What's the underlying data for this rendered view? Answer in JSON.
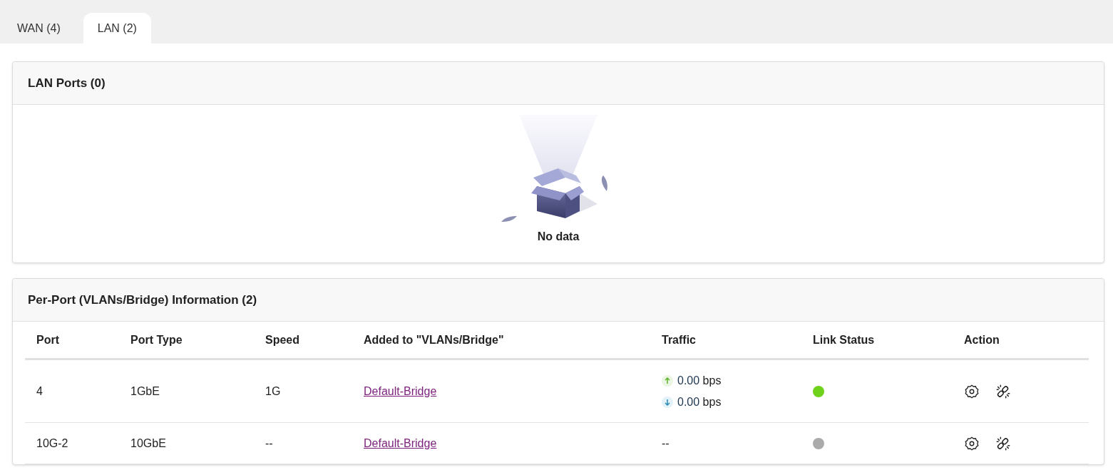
{
  "tabs": [
    {
      "label": "WAN (4)",
      "selected": false
    },
    {
      "label": "LAN (2)",
      "selected": true
    }
  ],
  "lan_ports": {
    "title": "LAN Ports (0)",
    "empty_text": "No data"
  },
  "per_port": {
    "title": "Per-Port (VLANs/Bridge) Information (2)",
    "columns": [
      "Port",
      "Port Type",
      "Speed",
      "Added to \"VLANs/Bridge\"",
      "Traffic",
      "Link Status",
      "Action"
    ],
    "rows": [
      {
        "port": "4",
        "port_type": "1GbE",
        "speed": "1G",
        "bridge": "Default-Bridge",
        "traffic": {
          "kind": "rates",
          "up": "0.00",
          "up_unit": "bps",
          "down": "0.00",
          "down_unit": "bps"
        },
        "color": "#6fd21a"
      },
      {
        "port": "10G-2",
        "port_type": "10GbE",
        "speed": "--",
        "bridge": "Default-Bridge",
        "traffic": {
          "kind": "text",
          "text": "--"
        },
        "color": "#aaaaaa"
      }
    ]
  }
}
